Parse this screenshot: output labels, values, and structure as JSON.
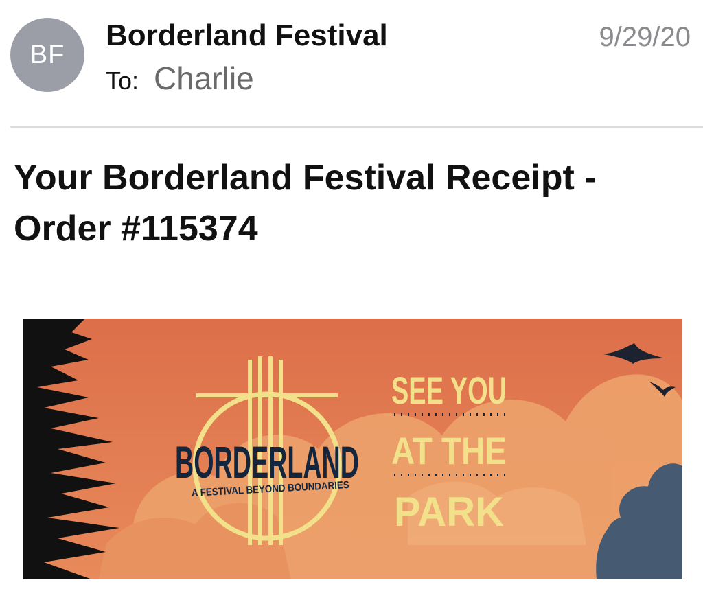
{
  "email": {
    "avatar_initials": "BF",
    "sender": "Borderland Festival",
    "date": "9/29/20",
    "to_label": "To:",
    "to_name": "Charlie",
    "subject": "Your Borderland Festival Receipt - Order #115374"
  },
  "banner": {
    "logo_title": "BORDERLAND",
    "logo_tagline": "A FESTIVAL BEYOND BOUNDARIES",
    "headline_lines": [
      "SEE YOU",
      "AT THE",
      "PARK"
    ],
    "colors": {
      "sky": "#e0774f",
      "cloud": "#eda26c",
      "logo_accent": "#f3e08a",
      "logo_text": "#14263d",
      "trees_left": "#111111",
      "tree_right": "#465a72"
    }
  }
}
